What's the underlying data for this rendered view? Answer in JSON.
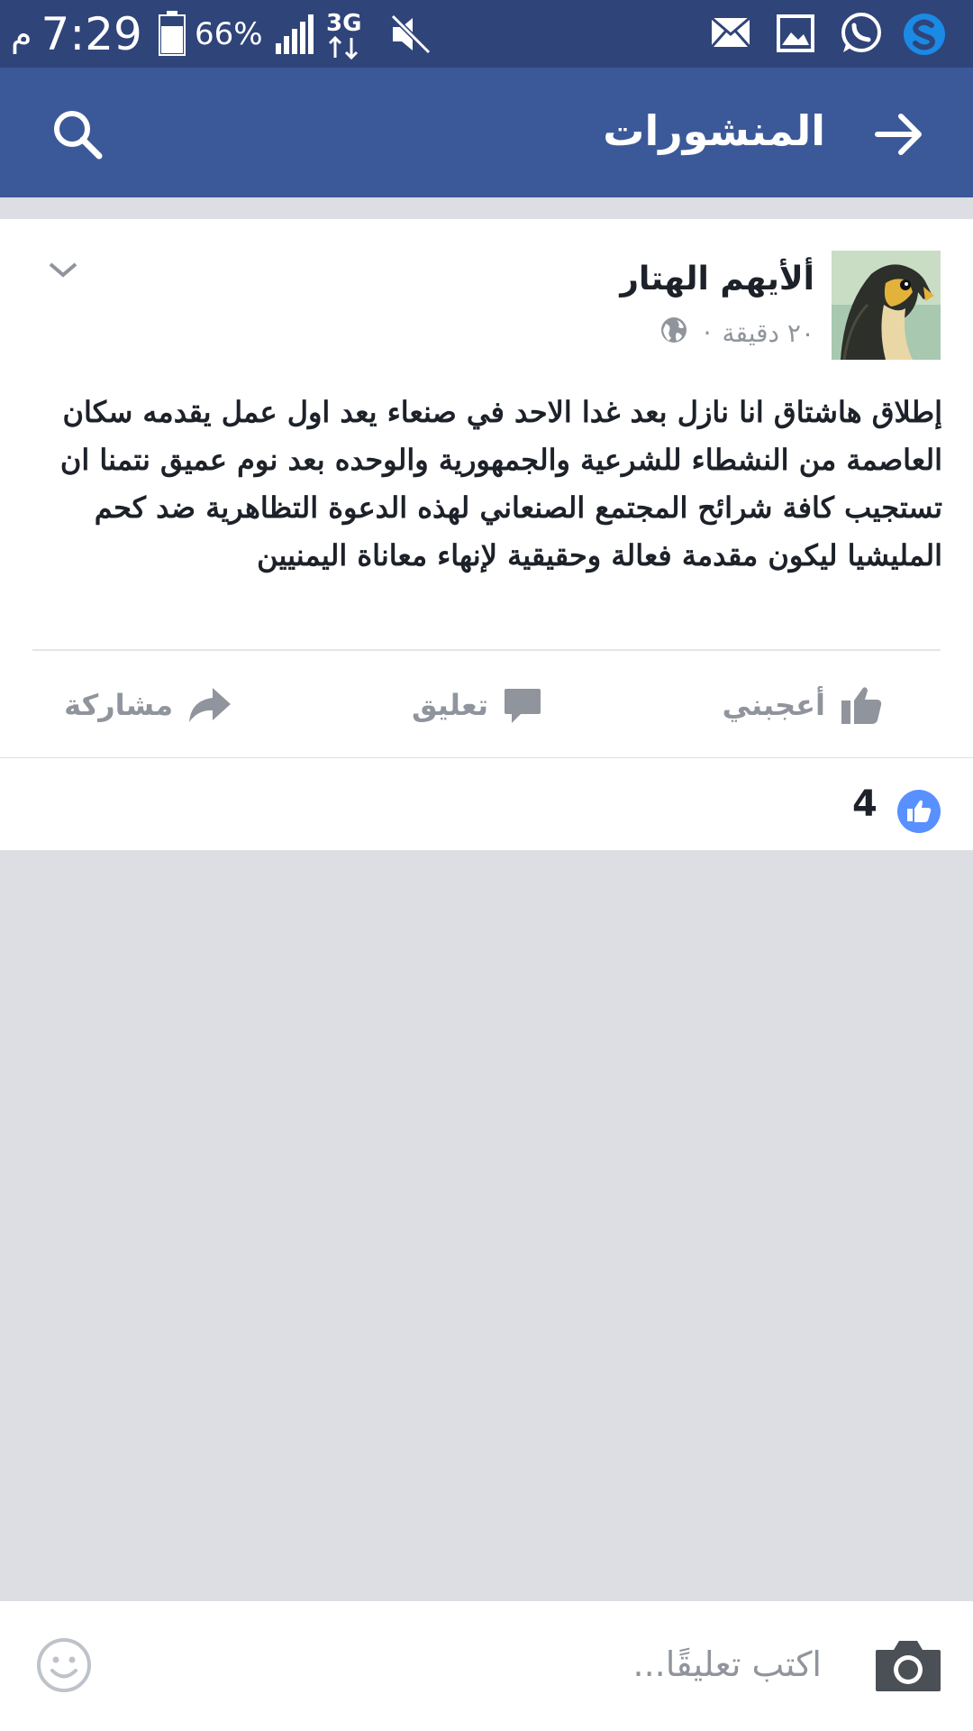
{
  "status_bar": {
    "time": "7:29",
    "ampm": "م",
    "battery_percent": "66%",
    "network": "3G"
  },
  "header": {
    "title": "المنشورات",
    "icons": [
      "arrow-right-icon",
      "search-icon"
    ]
  },
  "post": {
    "author": "ألأيهم الهتار",
    "timestamp": "٢٠ دقيقة",
    "separator": "·",
    "privacy_icon": "globe-icon",
    "text": "إطلاق هاشتاق انا نازل بعد غدا الاحد في صنعاء يعد اول عمل يقدمه سكان العاصمة من النشطاء للشرعية والجمهورية والوحده بعد نوم عميق نتمنا ان تستجيب كافة شرائح المجتمع الصنعاني لهذه الدعوة التظاهرية ضد كحم المليشيا ليكون مقدمة فعالة وحقيقية لإنهاء معاناة اليمنيين"
  },
  "actions": {
    "like": "أعجبني",
    "comment": "تعليق",
    "share": "مشاركة"
  },
  "reactions": {
    "like_count": "4"
  },
  "composer": {
    "placeholder": "اكتب تعليقًا..."
  },
  "colors": {
    "status_bar": "#2f4479",
    "app_bar": "#3b5998",
    "page_background": "#dcdee3",
    "text_primary": "#1d2129",
    "text_secondary": "#90949c",
    "like_blue": "#5890ff"
  }
}
